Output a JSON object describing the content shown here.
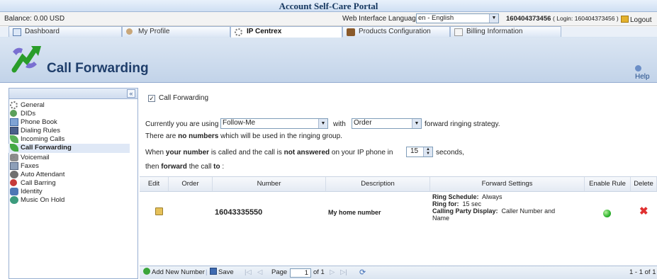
{
  "window": {
    "title": "Account Self-Care Portal"
  },
  "infobar": {
    "balance": "Balance: 0.00 USD",
    "language_label": "Web Interface Language:",
    "language_value": "en - English",
    "account_number": "160404373456",
    "account_login": "( Login: 160404373456 )",
    "logout": "Logout"
  },
  "tabs": [
    {
      "label": "Dashboard"
    },
    {
      "label": "My Profile"
    },
    {
      "label": "IP Centrex"
    },
    {
      "label": "Products Configuration"
    },
    {
      "label": "Billing Information"
    }
  ],
  "header": {
    "title": "Call Forwarding",
    "help": "Help"
  },
  "sidebar": {
    "collapse": "«",
    "items": [
      {
        "label": "General",
        "icon": "gear-icon"
      },
      {
        "label": "DIDs",
        "icon": "did-icon"
      },
      {
        "label": "Phone Book",
        "icon": "phonebook-icon"
      },
      {
        "label": "Dialing Rules",
        "icon": "dialing-rules-icon"
      },
      {
        "label": "Incoming Calls",
        "icon": "incoming-calls-icon"
      },
      {
        "label": "Call Forwarding",
        "icon": "call-forwarding-icon"
      },
      {
        "label": "Voicemail",
        "icon": "voicemail-icon"
      },
      {
        "label": "Faxes",
        "icon": "fax-icon"
      },
      {
        "label": "Auto Attendant",
        "icon": "auto-attendant-icon"
      },
      {
        "label": "Call Barring",
        "icon": "call-barring-icon"
      },
      {
        "label": "Identity",
        "icon": "identity-icon"
      },
      {
        "label": "Music On Hold",
        "icon": "music-icon"
      }
    ]
  },
  "main": {
    "enable_label": "Call Forwarding",
    "using_prefix": "Currently you are using",
    "mode_value": "Follow-Me",
    "with_label": "with",
    "strategy_value": "Order",
    "strategy_suffix": "forward ringing strategy.",
    "line2_a": "There are",
    "line2_b": "no numbers",
    "line2_c": "which will be used in the ringing group.",
    "line3_a": "When",
    "line3_b": "your number",
    "line3_c": "is called and the call is",
    "line3_d": "not answered",
    "line3_e": "on your IP phone in",
    "seconds_value": "15",
    "seconds_label": "seconds,",
    "line4_a": "then",
    "line4_b": "forward",
    "line4_c": "the call",
    "line4_d": "to",
    "line4_e": ":"
  },
  "grid": {
    "columns": [
      "Edit",
      "Order",
      "Number",
      "Description",
      "Forward Settings",
      "Enable Rule",
      "Delete"
    ],
    "rows": [
      {
        "number": "16043335550",
        "description": "My home number",
        "ring_schedule_label": "Ring Schedule:",
        "ring_schedule_value": "Always",
        "ring_for_label": "Ring for:",
        "ring_for_value": "15 sec",
        "cpd_label": "Calling Party Display:",
        "cpd_value": "Caller Number and",
        "cpd_value2": "Name"
      }
    ]
  },
  "pager": {
    "add": "Add New Number",
    "save": "Save",
    "page_label": "Page",
    "page_value": "1",
    "of_label": "of 1",
    "summary": "1 - 1 of 1"
  },
  "colors": {
    "enable_green": "#2fb52f",
    "delete_red": "#e03030",
    "header_blue": "#1f3e6b"
  }
}
